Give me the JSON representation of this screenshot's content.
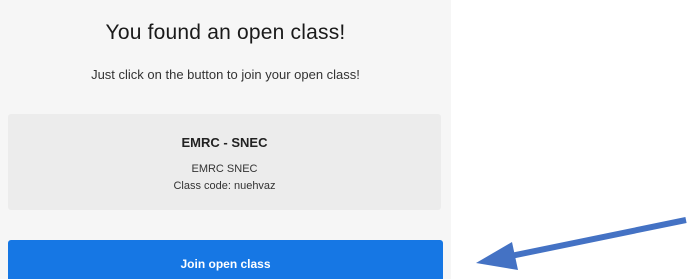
{
  "dialog": {
    "title": "You found an open class!",
    "subtitle": "Just click on the button to join your open class!"
  },
  "class_info": {
    "name": "EMRC - SNEC",
    "description": "EMRC SNEC",
    "code_line": "Class code: nuehvaz"
  },
  "actions": {
    "join_label": "Join open class"
  },
  "annotation": {
    "arrow_color": "#4472c4"
  },
  "colors": {
    "card_background": "#f6f6f6",
    "class_box_background": "#ececec",
    "button_background": "#1677e4"
  }
}
